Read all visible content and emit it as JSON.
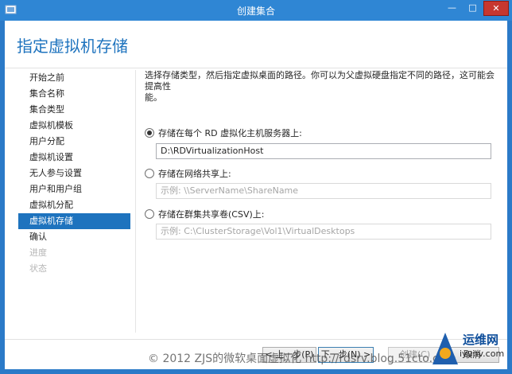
{
  "window": {
    "title": "创建集合",
    "minimize_glyph": "—",
    "maximize_glyph": "□",
    "close_glyph": "✕"
  },
  "page": {
    "title": "指定虚拟机存储"
  },
  "nav": {
    "items": [
      {
        "label": "开始之前",
        "state": "normal"
      },
      {
        "label": "集合名称",
        "state": "normal"
      },
      {
        "label": "集合类型",
        "state": "normal"
      },
      {
        "label": "虚拟机模板",
        "state": "normal"
      },
      {
        "label": "用户分配",
        "state": "normal"
      },
      {
        "label": "虚拟机设置",
        "state": "normal"
      },
      {
        "label": "无人参与设置",
        "state": "normal"
      },
      {
        "label": "用户和用户组",
        "state": "normal"
      },
      {
        "label": "虚拟机分配",
        "state": "normal"
      },
      {
        "label": "虚拟机存储",
        "state": "active"
      },
      {
        "label": "确认",
        "state": "normal"
      },
      {
        "label": "进度",
        "state": "disabled"
      },
      {
        "label": "状态",
        "state": "disabled"
      }
    ]
  },
  "content": {
    "description_line1": "选择存储类型，然后指定虚拟桌面的路径。你可以为父虚拟硬盘指定不同的路径，这可能会提高性",
    "description_line2": "能。",
    "options": [
      {
        "label": "存储在每个 RD 虚拟化主机服务器上:",
        "checked": true,
        "value": "D:\\RDVirtualizationHost",
        "placeholder": ""
      },
      {
        "label": "存储在网络共享上:",
        "checked": false,
        "value": "",
        "placeholder": "示例: \\\\ServerName\\ShareName"
      },
      {
        "label": "存储在群集共享卷(CSV)上:",
        "checked": false,
        "value": "",
        "placeholder": "示例: C:\\ClusterStorage\\Vol1\\VirtualDesktops"
      }
    ]
  },
  "buttons": {
    "prev": "< 上一步(P)",
    "next": "下一步(N) >",
    "create": "创建(C)",
    "cancel": "取消"
  },
  "watermark": "© 2012 ZJS的微软桌面虚拟化 http://rdsrv.blog.51cto.com",
  "brand": {
    "line1": "运维网",
    "line2": "iyunv.com"
  },
  "colors": {
    "accent": "#1e73be",
    "frame": "#2b7ac8",
    "close": "#c7372f"
  }
}
